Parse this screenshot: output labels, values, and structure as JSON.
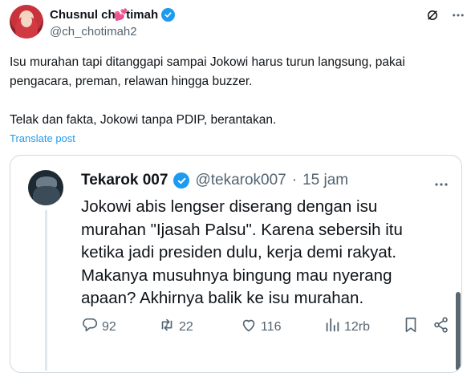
{
  "tweet": {
    "display_name": "Chusnul ch",
    "display_name_end": "timah",
    "heart": "💕",
    "handle": "@ch_chotimah2",
    "body": [
      "Isu murahan tapi ditanggapi sampai Jokowi harus turun langsung, pakai",
      "pengacara, preman, relawan hingga buzzer.",
      "",
      "Telak dan fakta, Jokowi tanpa PDIP, berantakan."
    ],
    "translate_label": "Translate post"
  },
  "quoted": {
    "display_name": "Tekarok 007",
    "handle": "@tekarok007",
    "separator": "·",
    "time": "15 jam",
    "lines": [
      "Jokowi abis lengser diserang dengan isu",
      "murahan \"Ijasah Palsu\". Karena sebersih itu",
      "ketika jadi presiden dulu, kerja demi rakyat.",
      "Makanya musuhnya bingung mau nyerang",
      "apaan? Akhirnya balik ke isu murahan."
    ],
    "replies": "92",
    "reposts": "22",
    "likes": "116",
    "views": "12rb"
  },
  "icons": [
    "grok-icon",
    "more-icon",
    "verified-badge-icon",
    "reply-icon",
    "repost-icon",
    "like-icon",
    "views-icon",
    "bookmark-icon",
    "share-icon"
  ],
  "colors": {
    "accent": "#1d9bf0",
    "text": "#0f1419",
    "secondary": "#536471",
    "border": "#cfd9de"
  }
}
